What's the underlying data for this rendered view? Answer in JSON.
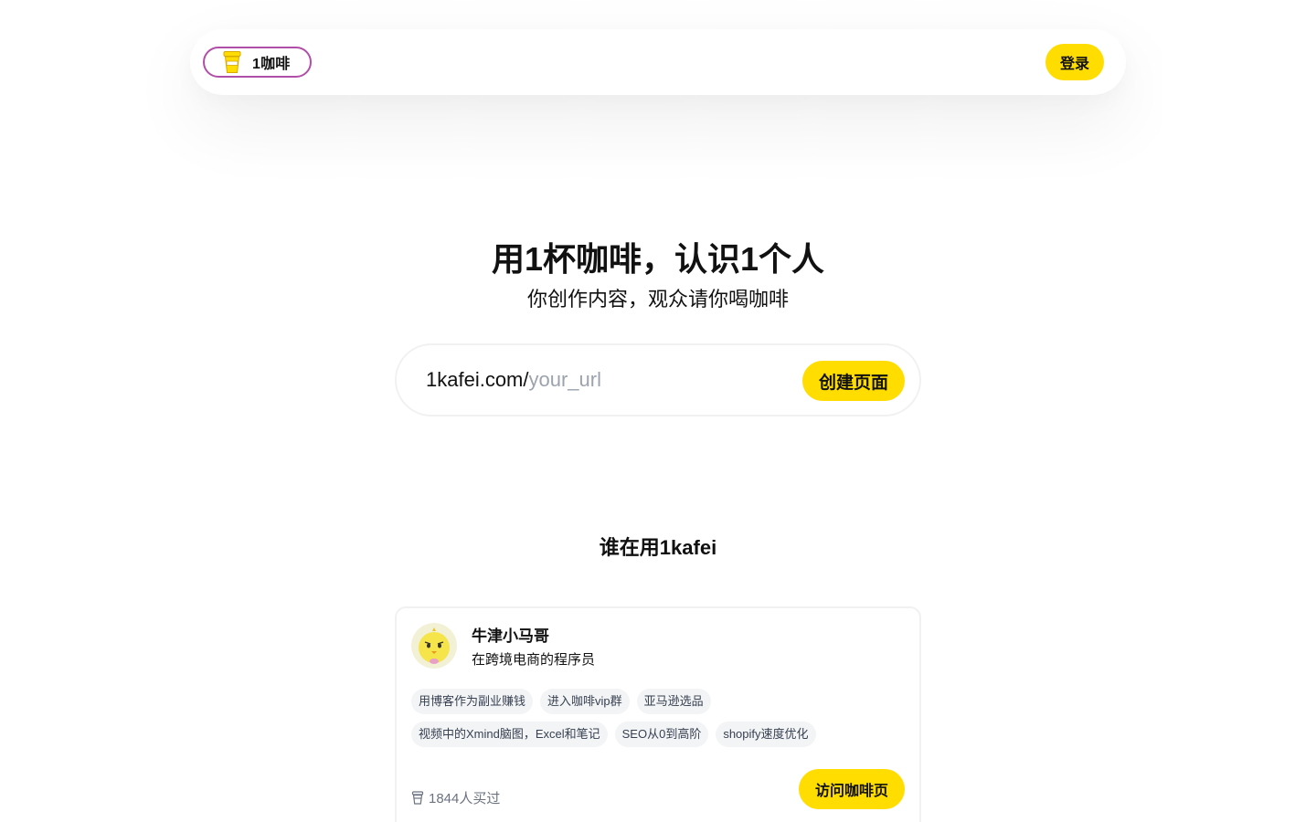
{
  "header": {
    "logo_text": "1咖啡",
    "login_label": "登录"
  },
  "hero": {
    "title": "用1杯咖啡，认识1个人",
    "subtitle": "你创作内容，观众请你喝咖啡",
    "url_prefix": "1kafei.com/",
    "url_placeholder": "your_url",
    "create_label": "创建页面"
  },
  "showcase": {
    "title": "谁在用1kafei",
    "cards": [
      {
        "name": "牛津小马哥",
        "description": "在跨境电商的程序员",
        "tag_rows": [
          [
            "用博客作为副业赚钱",
            "进入咖啡vip群",
            "亚马逊选品"
          ],
          [
            "视频中的Xmind脑图，Excel和笔记",
            "SEO从0到高阶",
            "shopify速度优化"
          ]
        ],
        "buyers": "1844人买过",
        "visit_label": "访问咖啡页"
      }
    ]
  },
  "colors": {
    "accent": "#ffdd00",
    "logo_border": "#b14fa8",
    "tag_bg": "#f3f4f6",
    "muted_text": "#6b7280",
    "placeholder": "#9ca3af"
  },
  "icons": {
    "logo": "coffee-cup-icon",
    "buyers": "coffee-cup-icon",
    "avatar": "yellow-chick-avatar"
  }
}
